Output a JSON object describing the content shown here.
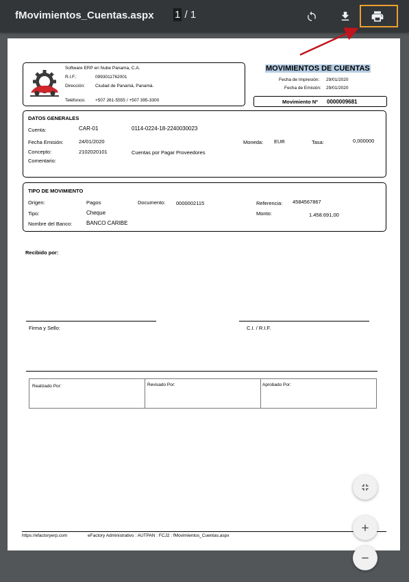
{
  "viewer": {
    "filename": "fMovimientos_Cuentas.aspx",
    "page_current": "1",
    "page_separator": " / ",
    "page_total": "1"
  },
  "header": {
    "company": "Software ERP en Nube Panama, C.A.",
    "rif_label": "R.I.F.:",
    "rif_value": "0993011762001",
    "dir_label": "Dirección:",
    "dir_value": "Ciudad de Panamá, Panamá.",
    "tel_label": "Teléfonos:",
    "tel_value": "+507 261-5555 / +507 395-3300",
    "doc_title": "MOVIMIENTOS DE CUENTAS",
    "fecha_impresion_label": "Fecha de Impresión:",
    "fecha_impresion": "29/01/2020",
    "fecha_emision_label": "Fecha de Emisión:",
    "fecha_emision": "29/01/2020",
    "movimiento_label": "Movimiento Nº",
    "movimiento_no": "0000009681"
  },
  "datos_generales": {
    "title": "DATOS GENERALES",
    "cuenta_label": "Cuenta:",
    "cuenta_code": "CAR-01",
    "cuenta_number": "0114-0224-18-2240030023",
    "fecha_emision_label": "Fecha Emisión:",
    "fecha_emision": "24/01/2020",
    "moneda_label": "Moneda:",
    "moneda": "EUR",
    "tasa_label": "Tasa:",
    "tasa": "0,000000",
    "concepto_label": "Concepto:",
    "concepto_code": "2102020101",
    "concepto_desc": "Cuentas por Pagar Proveedores",
    "comentario_label": "Comentario:"
  },
  "tipo_movimiento": {
    "title": "TIPO DE MOVIMIENTO",
    "origen_label": "Origen:",
    "origen": "Pagos",
    "documento_label": "Documento:",
    "documento": "0000002115",
    "referencia_label": "Referencia:",
    "referencia": "4584567867",
    "tipo_label": "Tipo:",
    "tipo": "Cheque",
    "monto_label": "Monto:",
    "monto": "1.458.691,00",
    "banco_label": "Nombre del Banco:",
    "banco": "BANCO CARIBE"
  },
  "firmas": {
    "recibido": "Recibido por:",
    "firma_sello": "Firma y Sello:",
    "ci_rif": "C.I. / R.I.F.",
    "realizado": "Realizado Por:",
    "revisado": "Revisado Por:",
    "aprobado": "Aprobado Por:"
  },
  "footer": {
    "url": "https://efactoryerp.com",
    "app": "eFactory Administrativo  :  AUTPAN  :  FCJ2  :  fMovimientos_Cuentas.aspx"
  },
  "colors": {
    "toolbar": "#323639",
    "background": "#525659",
    "highlight_border": "#f0a030",
    "arrow": "#c0141c",
    "title_highlight": "#b6cde3"
  }
}
